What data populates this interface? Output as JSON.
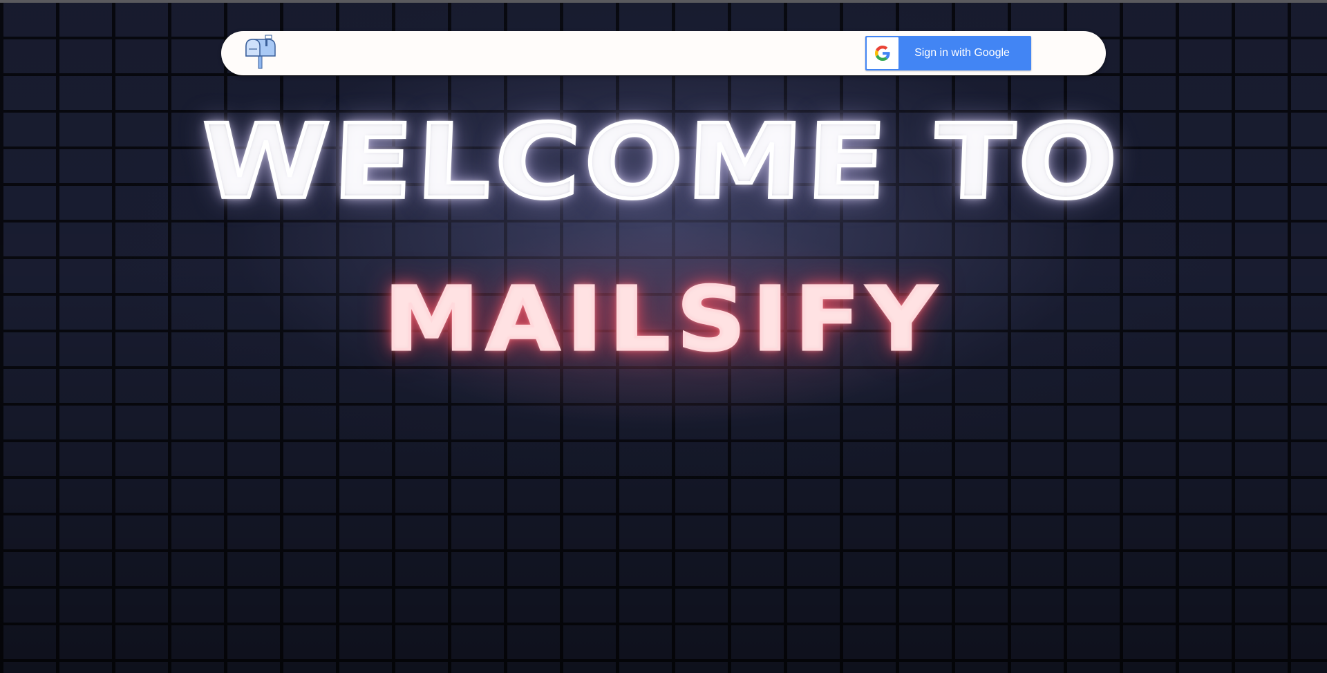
{
  "header": {
    "logo_icon": "mailbox-icon",
    "signin_button": {
      "label": "Sign in with Google",
      "icon": "google-g-icon"
    }
  },
  "hero": {
    "line1": "WELCOME TO",
    "line2": "MAILSIFY"
  },
  "colors": {
    "navbar_bg": "#fffcfa",
    "google_blue": "#4285f4",
    "wall": "#1a1e33",
    "neon_white": "#ffffff",
    "neon_pink": "#ff5a69"
  }
}
